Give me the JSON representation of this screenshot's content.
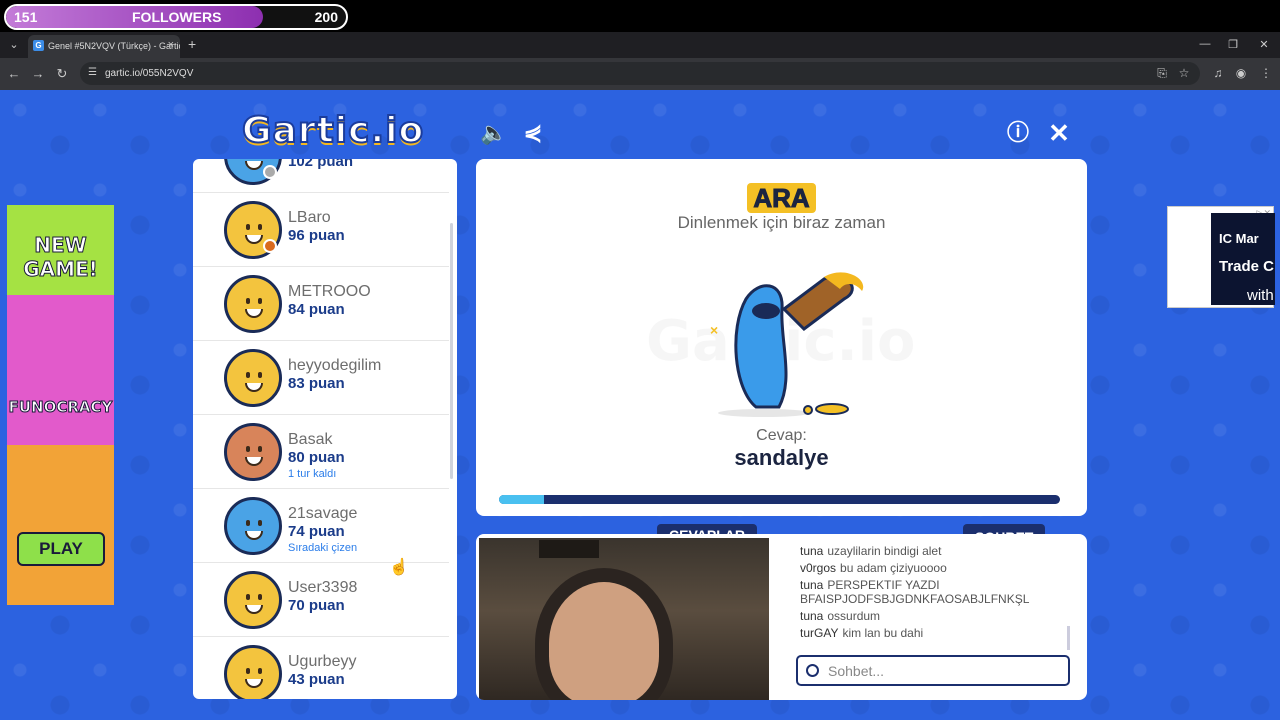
{
  "overlay": {
    "followers_current": "151",
    "followers_label": "FOLLOWERS",
    "followers_goal": "200",
    "progress": 0.755
  },
  "browser": {
    "tab_title": "Genel #5N2VQV (Türkçe) - Gartic.io",
    "url": "gartic.io/055N2VQV"
  },
  "header": {
    "logo": "Gartic.io"
  },
  "players": [
    {
      "name": "",
      "score": "102 puan",
      "note": "",
      "dot": "#aaaaaa",
      "avatar": "blue"
    },
    {
      "name": "LBaro",
      "score": "96 puan",
      "note": "",
      "dot": "#d96a1e",
      "avatar": "yellow"
    },
    {
      "name": "METROOO",
      "score": "84 puan",
      "note": "",
      "dot": "",
      "avatar": "yellow"
    },
    {
      "name": "heyyodegilim",
      "score": "83 puan",
      "note": "",
      "dot": "",
      "avatar": "yellow"
    },
    {
      "name": "Basak",
      "score": "80 puan",
      "note": "1 tur kaldı",
      "dot": "",
      "avatar": "brown"
    },
    {
      "name": "21savage",
      "score": "74 puan",
      "note": "Sıradaki çizen",
      "dot": "",
      "avatar": "blue"
    },
    {
      "name": "User3398",
      "score": "70 puan",
      "note": "",
      "dot": "",
      "avatar": "yellow"
    },
    {
      "name": "Ugurbeyy",
      "score": "43 puan",
      "note": "",
      "dot": "",
      "avatar": "yellow"
    }
  ],
  "main": {
    "status": "ARA",
    "subtitle": "Dinlenmek için biraz zaman",
    "answer_label": "Cevap:",
    "answer": "sandalye",
    "timer_progress": 0.08
  },
  "chat": {
    "tab_answers": "CEVAPLAR",
    "tab_chat": "SOHBET",
    "messages": [
      {
        "user": "tuna",
        "text": "uzaylilarin bindigi alet"
      },
      {
        "user": "v0rgos",
        "text": "bu adam çiziyuoooo"
      },
      {
        "user": "tuna",
        "text": "PERSPEKTIF YAZDI BFAISPJODFSBJGDNKFAOSABJLFNKŞL"
      },
      {
        "user": "tuna",
        "text": "ossurdum"
      },
      {
        "user": "turGAY",
        "text": "kim lan bu dahi"
      }
    ],
    "input_placeholder": "Sohbet..."
  },
  "ads": {
    "left_new": "NEW",
    "left_game": "GAME!",
    "left_brand": "FUNOCRACY",
    "left_play": "PLAY",
    "right_brand": "IC Mar",
    "right_line1": "Trade C",
    "right_line2": "with"
  }
}
